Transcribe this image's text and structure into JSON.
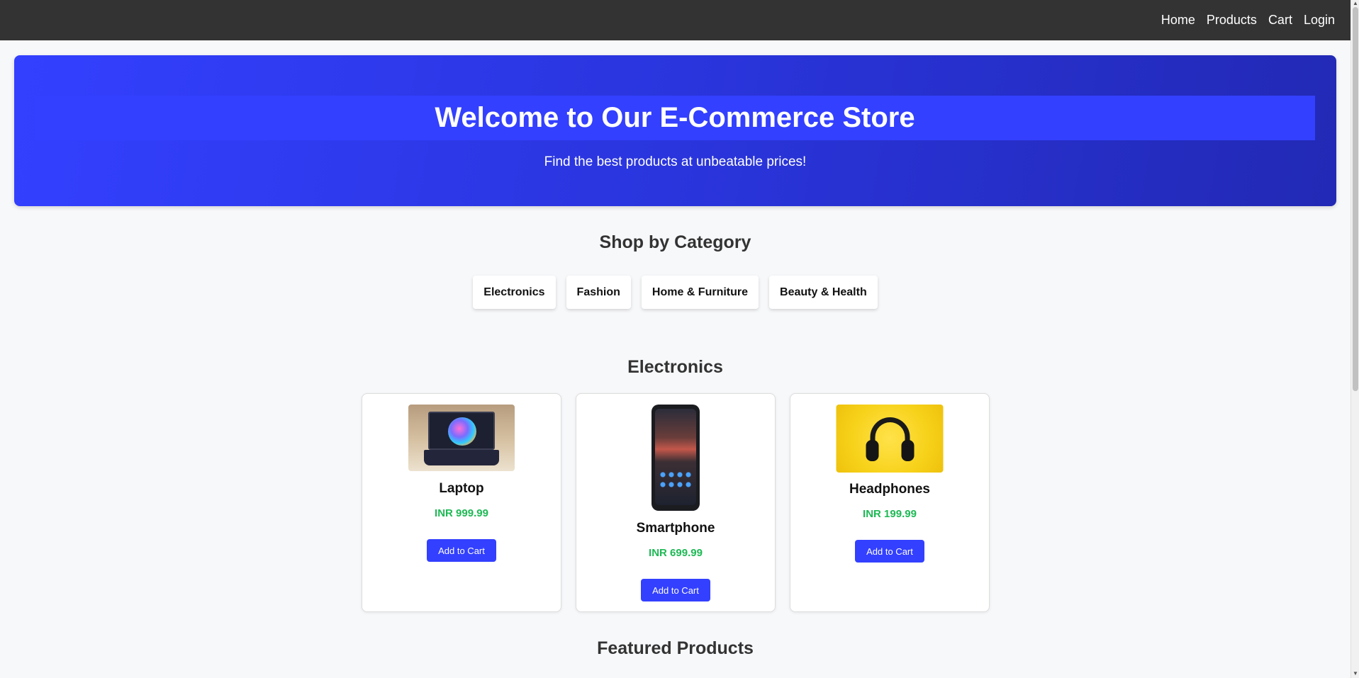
{
  "nav": {
    "links": [
      "Home",
      "Products",
      "Cart",
      "Login"
    ]
  },
  "hero": {
    "title": "Welcome to Our E-Commerce Store",
    "subtitle": "Find the best products at unbeatable prices!"
  },
  "categories": {
    "title": "Shop by Category",
    "items": [
      "Electronics",
      "Fashion",
      "Home & Furniture",
      "Beauty & Health"
    ]
  },
  "electronics": {
    "title": "Electronics",
    "products": [
      {
        "name": "Laptop",
        "price": "INR 999.99",
        "button": "Add to Cart",
        "image": "laptop-image"
      },
      {
        "name": "Smartphone",
        "price": "INR 699.99",
        "button": "Add to Cart",
        "image": "smartphone-image"
      },
      {
        "name": "Headphones",
        "price": "INR 199.99",
        "button": "Add to Cart",
        "image": "headphones-image"
      }
    ]
  },
  "featured": {
    "title": "Featured Products"
  },
  "colors": {
    "accent": "#3340ff",
    "navbar": "#333333",
    "price": "#1db954"
  }
}
